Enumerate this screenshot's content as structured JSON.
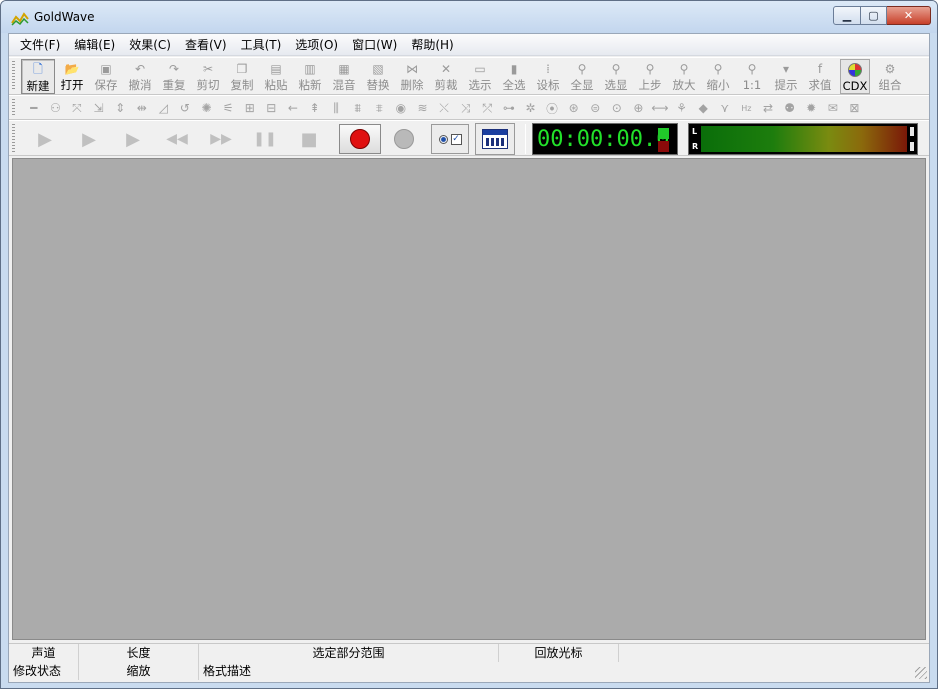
{
  "window": {
    "title": "GoldWave",
    "min_icon": "minimize-icon",
    "max_icon": "maximize-icon",
    "close_icon": "close-icon"
  },
  "menu": {
    "items": [
      {
        "id": "file",
        "label": "文件(F)"
      },
      {
        "id": "edit",
        "label": "编辑(E)"
      },
      {
        "id": "effects",
        "label": "效果(C)"
      },
      {
        "id": "view",
        "label": "查看(V)"
      },
      {
        "id": "tools",
        "label": "工具(T)"
      },
      {
        "id": "options",
        "label": "选项(O)"
      },
      {
        "id": "window",
        "label": "窗口(W)"
      },
      {
        "id": "help",
        "label": "帮助(H)"
      }
    ]
  },
  "toolbar_main": {
    "buttons": [
      {
        "id": "new",
        "label": "新建",
        "icon": "new-file-icon",
        "glyph": "🗋",
        "active": true,
        "pressed": true
      },
      {
        "id": "open",
        "label": "打开",
        "icon": "open-folder-icon",
        "glyph": "📂",
        "active": true,
        "pressed": false
      },
      {
        "id": "save",
        "label": "保存",
        "icon": "save-icon",
        "glyph": "▣",
        "active": false
      },
      {
        "id": "undo",
        "label": "撤消",
        "icon": "undo-icon",
        "glyph": "↶",
        "active": false
      },
      {
        "id": "redo",
        "label": "重复",
        "icon": "redo-icon",
        "glyph": "↷",
        "active": false
      },
      {
        "id": "cut",
        "label": "剪切",
        "icon": "scissors-icon",
        "glyph": "✂",
        "active": false
      },
      {
        "id": "copy",
        "label": "复制",
        "icon": "copy-icon",
        "glyph": "❐",
        "active": false
      },
      {
        "id": "paste",
        "label": "粘贴",
        "icon": "paste-icon",
        "glyph": "▤",
        "active": false
      },
      {
        "id": "paste_new",
        "label": "粘新",
        "icon": "paste-new-icon",
        "glyph": "▥",
        "active": false
      },
      {
        "id": "mix",
        "label": "混音",
        "icon": "mix-icon",
        "glyph": "▦",
        "active": false
      },
      {
        "id": "replace",
        "label": "替换",
        "icon": "replace-icon",
        "glyph": "▧",
        "active": false
      },
      {
        "id": "delete",
        "label": "删除",
        "icon": "delete-icon",
        "glyph": "⋈",
        "active": false
      },
      {
        "id": "trim",
        "label": "剪裁",
        "icon": "trim-icon",
        "glyph": "✕",
        "active": false
      },
      {
        "id": "select_show",
        "label": "选示",
        "icon": "select-view-icon",
        "glyph": "▭",
        "active": false
      },
      {
        "id": "select_all",
        "label": "全选",
        "icon": "select-all-icon",
        "glyph": "▮",
        "active": false
      },
      {
        "id": "set_marker",
        "label": "设标",
        "icon": "set-marker-icon",
        "glyph": "⁞",
        "active": false
      },
      {
        "id": "show_all",
        "label": "全显",
        "icon": "zoom-all-icon",
        "glyph": "⚲",
        "active": false
      },
      {
        "id": "show_selection",
        "label": "选显",
        "icon": "zoom-selection-icon",
        "glyph": "⚲",
        "active": false
      },
      {
        "id": "previous",
        "label": "上步",
        "icon": "zoom-previous-icon",
        "glyph": "⚲",
        "active": false
      },
      {
        "id": "zoom_in",
        "label": "放大",
        "icon": "zoom-in-icon",
        "glyph": "⚲",
        "active": false
      },
      {
        "id": "zoom_out",
        "label": "缩小",
        "icon": "zoom-out-icon",
        "glyph": "⚲",
        "active": false
      },
      {
        "id": "zoom_1_1",
        "label": "1:1",
        "icon": "zoom-1-1-icon",
        "glyph": "⚲",
        "active": false
      },
      {
        "id": "cue",
        "label": "提示",
        "icon": "cue-icon",
        "glyph": "▾",
        "active": false
      },
      {
        "id": "evaluate",
        "label": "求值",
        "icon": "function-icon",
        "glyph": "f",
        "active": false
      }
    ],
    "cdx": {
      "label": "CDX",
      "icon": "cd-disc-icon"
    },
    "combine": {
      "label": "组合",
      "icon": "combine-icon",
      "glyph": "⚙"
    }
  },
  "toolbar_effects": {
    "icons": [
      "noise-reduction-icon",
      "echo-icon",
      "mechanize-icon",
      "reverse-icon",
      "compress-icon",
      "time-warp-icon",
      "volume-shape-icon",
      "doppler-icon",
      "offset-icon",
      "flanger-icon",
      "equalizer-icon",
      "filter-icon",
      "shift-left-icon",
      "pitch-icon",
      "bandpass-icon",
      "spectrum-icon",
      "fade-icon",
      "noise-icon",
      "stereo-icon",
      "tone-icon",
      "wave-icon",
      "resample-icon",
      "playback-rate-icon",
      "dynamics-icon",
      "limiter-icon",
      "auto-gain-icon",
      "silence-icon",
      "swap-channels-icon",
      "invert-icon",
      "channel-mixer-icon",
      "interpolate-icon",
      "declick-icon",
      "decrackle-icon",
      "dehum-icon",
      "hz-icon",
      "expand-icon",
      "record-effect-icon",
      "burn-icon",
      "envelope-icon"
    ],
    "glyphs": [
      "━",
      "⚇",
      "⤧",
      "⇲",
      "⇕",
      "⇹",
      "◿",
      "↺",
      "✺",
      "⚟",
      "⊞",
      "⊟",
      "←",
      "⇞",
      "⫼",
      "⩩",
      "⩨",
      "◉",
      "≋",
      "⤬",
      "⤨",
      "⤱",
      "⊶",
      "✲",
      "⦿",
      "⊛",
      "⊜",
      "⊙",
      "⊕",
      "⟷",
      "⚘",
      "◆",
      "⋎",
      "Hz",
      "⇄",
      "⚉",
      "✹",
      "✉",
      "⊠"
    ]
  },
  "transport": {
    "play_icon": "play-icon",
    "play_glyph": "▶",
    "play_selection_icon": "play-selection-icon",
    "play_selection_glyph": "▶",
    "play_cursor_icon": "play-from-cursor-icon",
    "play_cursor_glyph": "▶",
    "rewind_icon": "rewind-icon",
    "rewind_glyph": "◀◀",
    "forward_icon": "fast-forward-icon",
    "forward_glyph": "▶▶",
    "pause_icon": "pause-icon",
    "pause_glyph": "❚❚",
    "stop_icon": "stop-icon",
    "stop_glyph": "■",
    "record_icon": "record-icon",
    "record_selection_icon": "record-selection-icon",
    "check_mark": "✓",
    "control_icon": "control-panel-icon"
  },
  "display": {
    "time": "00:00:00.0",
    "meter_left_label": "L",
    "meter_right_label": "R"
  },
  "statusbar": {
    "row1": [
      "声道",
      "长度",
      "选定部分范围",
      "回放光标",
      ""
    ],
    "row2": [
      "修改状态",
      "缩放",
      "格式描述"
    ]
  },
  "colors": {
    "time_digits": "#22e22a",
    "record": "#e01010",
    "workspace": "#ababab"
  }
}
